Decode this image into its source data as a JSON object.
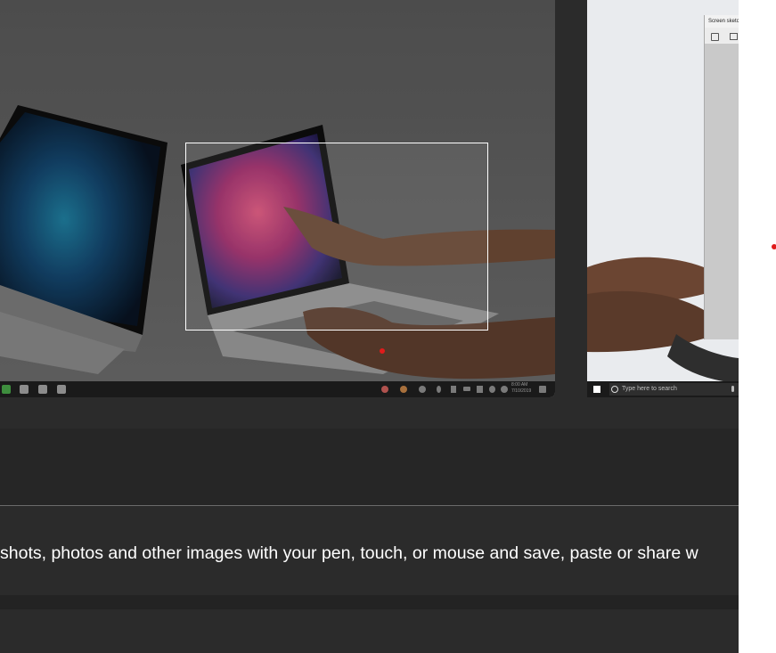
{
  "gallery": {
    "screenshot1": {
      "taskbar_clock_time": "8:00 AM",
      "taskbar_clock_date": "7/10/2019"
    },
    "screenshot2": {
      "search_placeholder": "Type here to search",
      "window_title": "Screen sketch"
    }
  },
  "description": {
    "text": "shots, photos and other images with your pen, touch, or mouse and save, paste or share w"
  },
  "colors": {
    "selection_border": "#ffffff",
    "laser_dot": "#e01b1b",
    "page_background": "#2b2b2b"
  }
}
